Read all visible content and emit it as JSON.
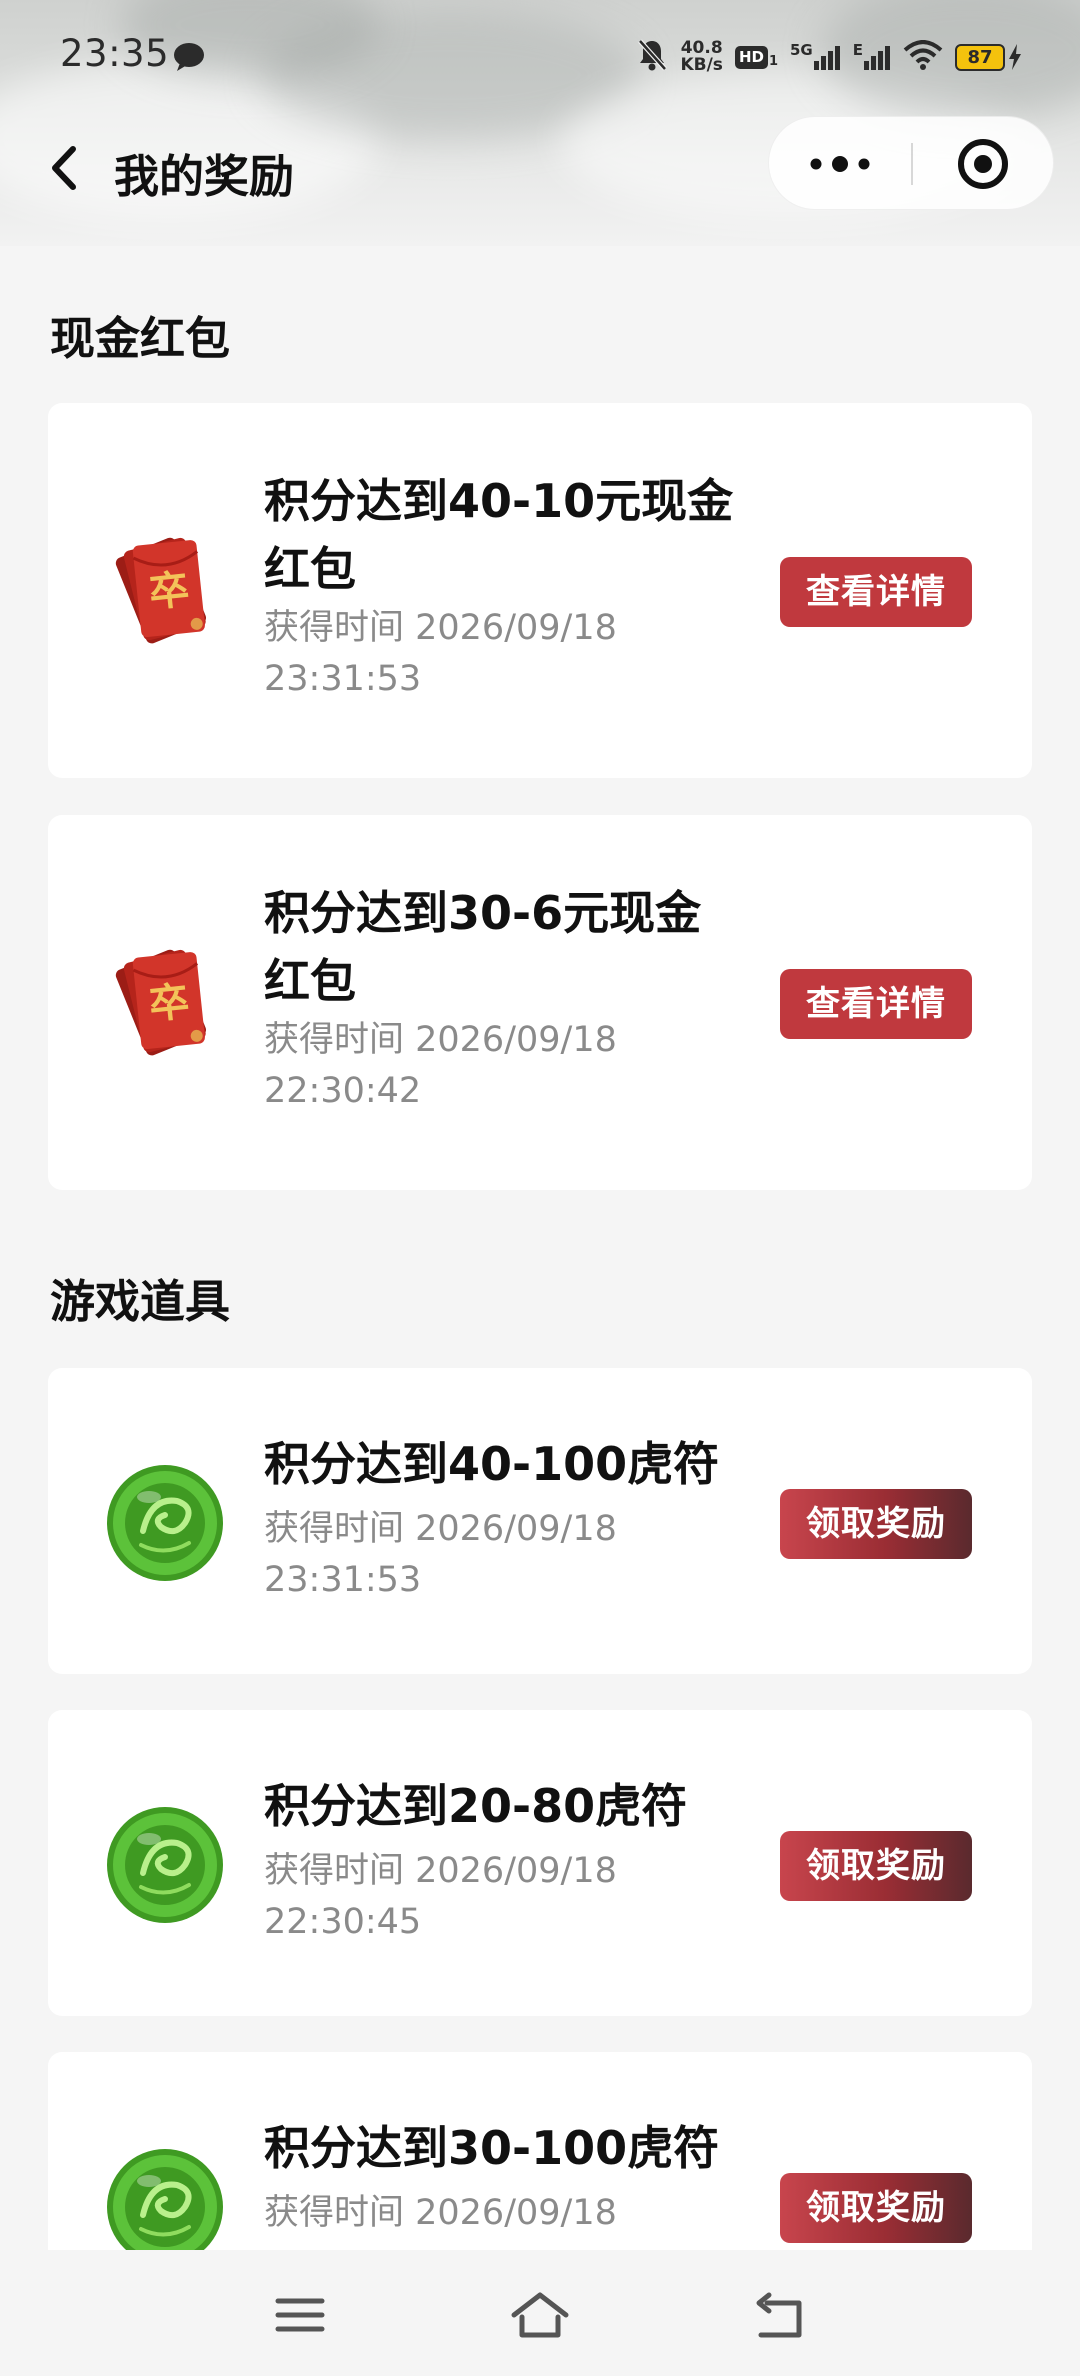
{
  "status_bar": {
    "time": "23:35",
    "net_speed_value": "40.8",
    "net_speed_unit": "KB/s",
    "hd_label": "HD",
    "hd_sub": "1",
    "fiveg_label": "5G",
    "e_label": "E",
    "battery": "87"
  },
  "nav": {
    "title": "我的奖励"
  },
  "sections": [
    {
      "title": "现金红包",
      "items": [
        {
          "title_line1": "积分达到40-10元现金",
          "title_line2": "红包",
          "time_line1": "获得时间 2026/09/18",
          "time_line2": "23:31:53",
          "button": "查看详情",
          "icon": "red-envelope-icon"
        },
        {
          "title_line1": "积分达到30-6元现金",
          "title_line2": "红包",
          "time_line1": "获得时间 2026/09/18",
          "time_line2": "22:30:42",
          "button": "查看详情",
          "icon": "red-envelope-icon"
        }
      ]
    },
    {
      "title": "游戏道具",
      "items": [
        {
          "title_line1": "积分达到40-100虎符",
          "time_line1": "获得时间 2026/09/18",
          "time_line2": "23:31:53",
          "button": "领取奖励",
          "icon": "jade-token-icon"
        },
        {
          "title_line1": "积分达到20-80虎符",
          "time_line1": "获得时间 2026/09/18",
          "time_line2": "22:30:45",
          "button": "领取奖励",
          "icon": "jade-token-icon"
        },
        {
          "title_line1": "积分达到30-100虎符",
          "time_line1": "获得时间 2026/09/18",
          "button": "领取奖励",
          "icon": "jade-token-icon"
        }
      ]
    }
  ],
  "colors": {
    "button_red": "#c0393e",
    "page_background": "#f5f5f5",
    "battery_yellow": "#f4c20d",
    "jade_green": "#4caf2a"
  }
}
